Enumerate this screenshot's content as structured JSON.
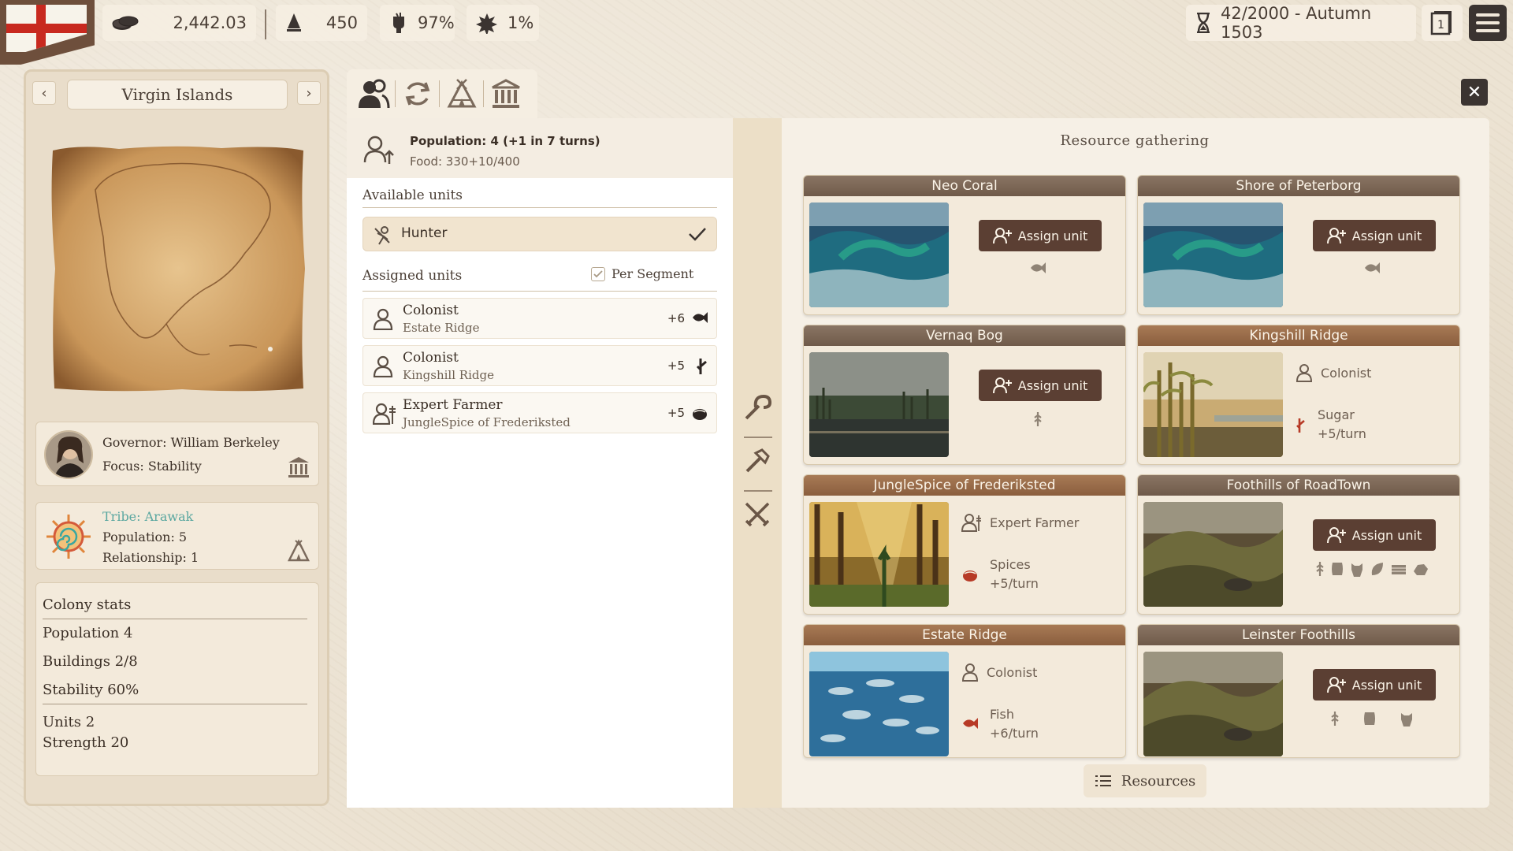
{
  "topbar": {
    "gold": "2,442.03",
    "ships": "450",
    "approval": "97%",
    "unrest": "1%",
    "turn_date": "42/2000 - Autumn 1503"
  },
  "colony": {
    "name": "Virgin Islands",
    "prev": "‹",
    "next": "›",
    "governor": "Governor: William Berkeley",
    "focus": "Focus: Stability",
    "tribe": "Tribe: Arawak",
    "tribe_population": "Population: 5",
    "relationship": "Relationship: 1"
  },
  "stats": {
    "title": "Colony stats",
    "population": "Population 4",
    "buildings": "Buildings 2/8",
    "stability": "Stability 60%",
    "units": "Units 2",
    "strength": "Strength 20"
  },
  "population_box": {
    "line1": "Population: 4 (+1 in 7 turns)",
    "line2": "Food: 330+10/400"
  },
  "available": {
    "header": "Available units",
    "units": [
      {
        "name": "Hunter"
      }
    ]
  },
  "assigned": {
    "header": "Assigned units",
    "per_segment": "Per Segment",
    "units": [
      {
        "name": "Colonist",
        "location": "Estate Ridge",
        "amount": "+6",
        "resource_icon": "fish-icon"
      },
      {
        "name": "Colonist",
        "location": "Kingshill Ridge",
        "amount": "+5",
        "resource_icon": "sugar-icon"
      },
      {
        "name": "Expert Farmer",
        "location": "JungleSpice of Frederiksted",
        "amount": "+5",
        "resource_icon": "spices-icon"
      }
    ]
  },
  "resource_gathering": {
    "title": "Resource gathering",
    "assign_label": "Assign unit",
    "tiles": [
      {
        "name": "Neo Coral",
        "occupied": false,
        "image": "sea-waves"
      },
      {
        "name": "Shore of Peterborg",
        "occupied": false,
        "image": "sea-waves"
      },
      {
        "name": "Vernaq Bog",
        "occupied": false,
        "image": "swamp"
      },
      {
        "name": "Kingshill Ridge",
        "occupied": true,
        "image": "sugarcane",
        "unit": "Colonist",
        "resource": "Sugar",
        "rate": "+5/turn"
      },
      {
        "name": "JungleSpice of Frederiksted",
        "occupied": true,
        "image": "forest",
        "unit": "Expert Farmer",
        "resource": "Spices",
        "rate": "+5/turn"
      },
      {
        "name": "Foothills of RoadTown",
        "occupied": false,
        "image": "hills"
      },
      {
        "name": "Estate Ridge",
        "occupied": true,
        "image": "fish-school",
        "unit": "Colonist",
        "resource": "Fish",
        "rate": "+6/turn"
      },
      {
        "name": "Leinster Foothills",
        "occupied": false,
        "image": "hills"
      }
    ],
    "resources_button": "Resources"
  },
  "colors": {
    "assign_button": "#5b3f33",
    "tile_header": "#7c6756",
    "tribe_text": "#5aa7a0",
    "flag_red": "#c8291f"
  }
}
